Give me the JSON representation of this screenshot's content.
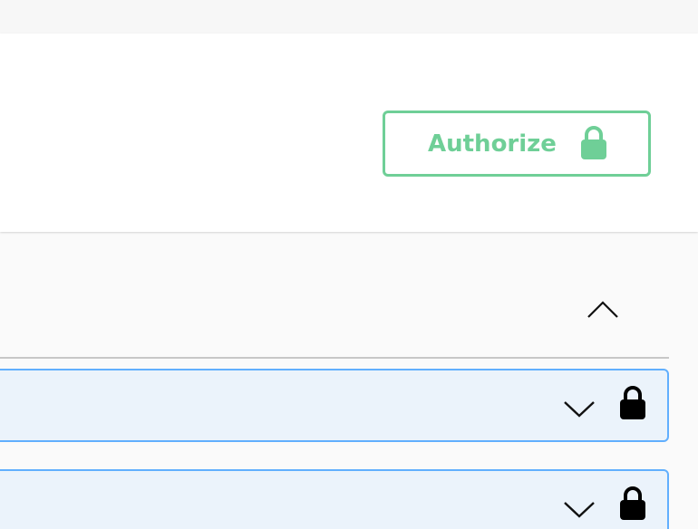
{
  "header": {
    "authorize_label": "Authorize",
    "authorize_icon": "lock-icon",
    "accent_color": "#6fcf97"
  },
  "section": {
    "toggle_icon": "chevron-up-icon",
    "expanded": true
  },
  "operations": [
    {
      "icons": [
        "chevron-down-icon",
        "lock-icon"
      ],
      "border_color": "#61affe",
      "background": "#ebf3fb"
    },
    {
      "icons": [
        "chevron-down-icon",
        "lock-icon"
      ],
      "border_color": "#61affe",
      "background": "#ebf3fb"
    }
  ]
}
